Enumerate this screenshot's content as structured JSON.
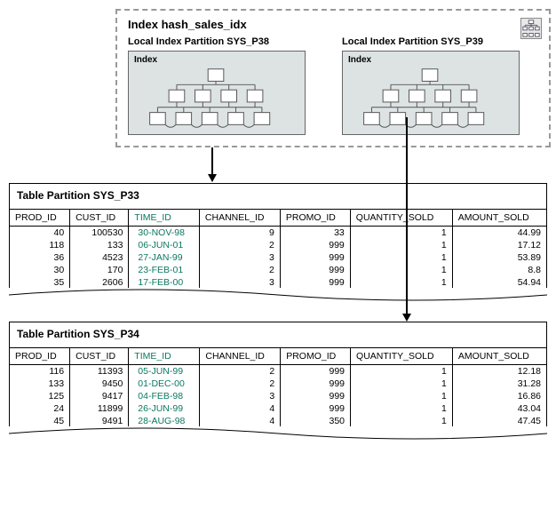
{
  "index": {
    "title": "Index hash_sales_idx",
    "partitions": [
      {
        "label": "Local Index Partition SYS_P38",
        "box": "Index"
      },
      {
        "label": "Local Index Partition SYS_P39",
        "box": "Index"
      }
    ]
  },
  "tables": [
    {
      "title": "Table Partition SYS_P33",
      "columns": [
        "PROD_ID",
        "CUST_ID",
        "TIME_ID",
        "CHANNEL_ID",
        "PROMO_ID",
        "QUANTITY_SOLD",
        "AMOUNT_SOLD"
      ],
      "rows": [
        [
          "40",
          "100530",
          "30-NOV-98",
          "9",
          "33",
          "1",
          "44.99"
        ],
        [
          "118",
          "133",
          "06-JUN-01",
          "2",
          "999",
          "1",
          "17.12"
        ],
        [
          "36",
          "4523",
          "27-JAN-99",
          "3",
          "999",
          "1",
          "53.89"
        ],
        [
          "30",
          "170",
          "23-FEB-01",
          "2",
          "999",
          "1",
          "8.8"
        ],
        [
          "35",
          "2606",
          "17-FEB-00",
          "3",
          "999",
          "1",
          "54.94"
        ]
      ]
    },
    {
      "title": "Table Partition SYS_P34",
      "columns": [
        "PROD_ID",
        "CUST_ID",
        "TIME_ID",
        "CHANNEL_ID",
        "PROMO_ID",
        "QUANTITY_SOLD",
        "AMOUNT_SOLD"
      ],
      "rows": [
        [
          "116",
          "11393",
          "05-JUN-99",
          "2",
          "999",
          "1",
          "12.18"
        ],
        [
          "133",
          "9450",
          "01-DEC-00",
          "2",
          "999",
          "1",
          "31.28"
        ],
        [
          "125",
          "9417",
          "04-FEB-98",
          "3",
          "999",
          "1",
          "16.86"
        ],
        [
          "24",
          "11899",
          "26-JUN-99",
          "4",
          "999",
          "1",
          "43.04"
        ],
        [
          "45",
          "9491",
          "28-AUG-98",
          "4",
          "350",
          "1",
          "47.45"
        ]
      ]
    }
  ]
}
